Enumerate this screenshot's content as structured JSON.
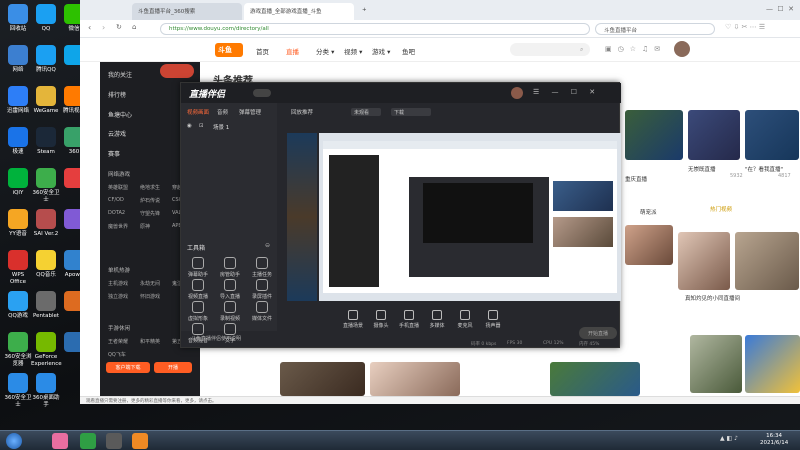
{
  "desktop_icons": [
    {
      "label": "回收站",
      "color": "#3a8ee6",
      "col": 0,
      "row": 0,
      "name": "recycle-bin-icon"
    },
    {
      "label": "网络",
      "color": "#3c7fd0",
      "col": 0,
      "row": 1,
      "name": "network-icon"
    },
    {
      "label": "迅雷网络",
      "color": "#2d7ef7",
      "col": 0,
      "row": 2,
      "name": "xunlei-icon"
    },
    {
      "label": "极速",
      "color": "#1a73e8",
      "col": 0,
      "row": 3,
      "name": "browser-icon"
    },
    {
      "label": "iQIY",
      "color": "#00b23c",
      "col": 0,
      "row": 4,
      "name": "iqiyi-icon"
    },
    {
      "label": "YY语音",
      "color": "#f5a623",
      "col": 0,
      "row": 5,
      "name": "yy-icon"
    },
    {
      "label": "WPS Office",
      "color": "#d9302c",
      "col": 0,
      "row": 6,
      "name": "wps-icon"
    },
    {
      "label": "QQ游戏",
      "color": "#2aa1f2",
      "col": 0,
      "row": 7,
      "name": "qqgame-icon"
    },
    {
      "label": "360安全浏览器",
      "color": "#3dae4b",
      "col": 0,
      "row": 8,
      "name": "360-browser-icon"
    },
    {
      "label": "360安全卫士",
      "color": "#2b8be6",
      "col": 0,
      "row": 9,
      "name": "360-safe-icon"
    },
    {
      "label": "QQ",
      "color": "#1ba0f2",
      "col": 1,
      "row": 0,
      "name": "qq-icon"
    },
    {
      "label": "腾讯QQ",
      "color": "#1ba0f2",
      "col": 1,
      "row": 1,
      "name": "tencent-qq-icon"
    },
    {
      "label": "WeGame",
      "color": "#e4b53a",
      "col": 1,
      "row": 2,
      "name": "wegame-icon"
    },
    {
      "label": "Steam",
      "color": "#1b2838",
      "col": 1,
      "row": 3,
      "name": "steam-icon"
    },
    {
      "label": "360安全卫士",
      "color": "#3dae4b",
      "col": 1,
      "row": 4,
      "name": "360-guard-icon"
    },
    {
      "label": "SAI Ver.2",
      "color": "#b64d4d",
      "col": 1,
      "row": 5,
      "name": "sai-icon"
    },
    {
      "label": "QQ音乐",
      "color": "#f5d132",
      "col": 1,
      "row": 6,
      "name": "qqmusic-icon"
    },
    {
      "label": "Pentablet",
      "color": "#6b6b6b",
      "col": 1,
      "row": 7,
      "name": "pentablet-icon"
    },
    {
      "label": "GeForce Experience",
      "color": "#76b900",
      "col": 1,
      "row": 8,
      "name": "geforce-icon"
    },
    {
      "label": "360桌面助手",
      "color": "#2b8be6",
      "col": 1,
      "row": 9,
      "name": "360-desktop-icon"
    },
    {
      "label": "微信",
      "color": "#2dc100",
      "col": 2,
      "row": 0,
      "name": "wechat-icon"
    },
    {
      "label": "",
      "color": "#0ea5e9",
      "col": 2,
      "row": 1,
      "name": "app-icon"
    },
    {
      "label": "腾讯视频",
      "color": "#ff7a00",
      "col": 2,
      "row": 2,
      "name": "tencent-video-icon"
    },
    {
      "label": "360",
      "color": "#38a169",
      "col": 2,
      "row": 3,
      "name": "app2-icon"
    },
    {
      "label": "",
      "color": "#e53e3e",
      "col": 2,
      "row": 4,
      "name": "app3-icon"
    },
    {
      "label": "",
      "color": "#805ad5",
      "col": 2,
      "row": 5,
      "name": "app4-icon"
    },
    {
      "label": "Apowe",
      "color": "#3182ce",
      "col": 2,
      "row": 6,
      "name": "apowersoft-icon"
    },
    {
      "label": "",
      "color": "#dd6b20",
      "col": 2,
      "row": 7,
      "name": "app5-icon"
    },
    {
      "label": "",
      "color": "#2b6cb0",
      "col": 2,
      "row": 8,
      "name": "app6-icon"
    }
  ],
  "browser": {
    "tabs": [
      "斗鱼直播平台_360搜索",
      "游戏直播_全部游戏直播_斗鱼",
      "+"
    ],
    "url": "https://www.douyu.com/directory/all",
    "search_text": "斗鱼直播平台",
    "status_text": "观看直播只需要注册，更多的精彩直播等你来看，更多，请点击。"
  },
  "site": {
    "logo": "斗鱼",
    "nav": [
      "首页",
      "直播",
      "分类 ▾",
      "视频 ▾",
      "游戏 ▾",
      "鱼吧"
    ],
    "section_title": "头条推荐"
  },
  "sidebar": {
    "items": [
      "我的关注",
      "排行榜",
      "鱼塘中心",
      "云游戏",
      "赛事"
    ],
    "headings": [
      "网络游戏",
      "单机热游",
      "手游休闲"
    ],
    "games": [
      "英雄联盟",
      "绝地求生",
      "穿越火线",
      "CF/OD",
      "炉石传说",
      "CSGO",
      "DOTA2",
      "守望先锋",
      "VALORA...",
      "魔兽世界",
      "原神",
      "APEX"
    ],
    "single": [
      "主机游戏",
      "永劫无间",
      "鬼泣猎天",
      "独立游戏",
      "怀旧游戏"
    ],
    "mobile": [
      "王者荣耀",
      "和平精英",
      "第五人格",
      "QQ飞车"
    ],
    "download_btn": "客户端下载",
    "open_btn": "开播"
  },
  "thumbs_captions": [
    {
      "title": "无崇既直播",
      "count": "5932"
    },
    {
      "title": "\"在？看我直播\"",
      "count": "4817"
    },
    {
      "title": "重庆直播",
      "count": ""
    },
    {
      "title": "萌宠派",
      "count": ""
    },
    {
      "title": "热门视频",
      "count": ""
    },
    {
      "title": "真知灼见的小同直播间",
      "count": ""
    }
  ],
  "app": {
    "title": "直播伴侣",
    "tabs": [
      "视频画面",
      "音频",
      "弹幕管理"
    ],
    "scene_label": "场景 1",
    "panel_top": [
      "回放推荐",
      "未观看",
      "下载"
    ],
    "tools_title": "工具箱",
    "tools": [
      "弹幕助手",
      "房管助手",
      "主播任务",
      "视频直播",
      "导入直播",
      "录屏插件",
      "虚拟形象",
      "录制视频",
      "媒体文件",
      "音频混音",
      "文字"
    ],
    "controls": [
      "直播场景",
      "摄像头",
      "手机直播",
      "多媒体",
      "麦克风",
      "扬声器"
    ],
    "start_button": "开始直播",
    "notice": "斗鱼直播伴侣使用说明",
    "bottom_stats": [
      "码率 0 kbps",
      "FPS 30",
      "CPU 12%",
      "内存 45%"
    ]
  },
  "taskbar": {
    "time": "16:34",
    "date": "2021/6/14"
  }
}
